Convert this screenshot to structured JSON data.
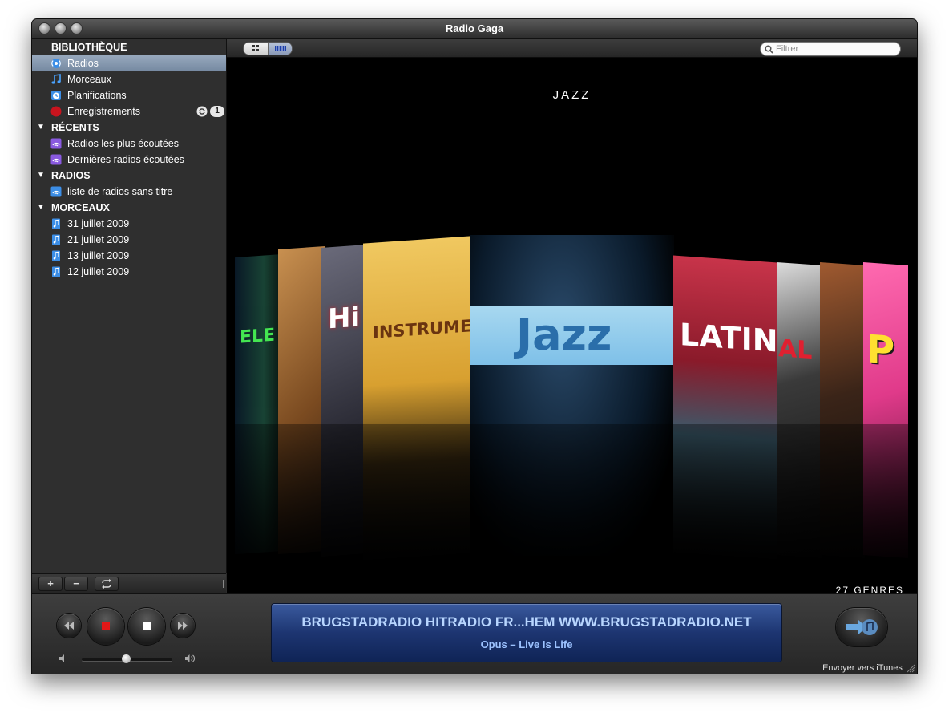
{
  "window": {
    "title": "Radio Gaga"
  },
  "sidebar": {
    "library_header": "BIBLIOTHÈQUE",
    "library_items": [
      {
        "label": "Radios",
        "icon": "radio-icon",
        "selected": true
      },
      {
        "label": "Morceaux",
        "icon": "music-note-icon"
      },
      {
        "label": "Planifications",
        "icon": "clock-icon"
      },
      {
        "label": "Enregistrements",
        "icon": "record-icon",
        "badge": "1"
      }
    ],
    "recent_header": "RÉCENTS",
    "recent_items": [
      {
        "label": "Radios les plus écoutées",
        "icon": "playlist-icon"
      },
      {
        "label": "Dernières radios écoutées",
        "icon": "playlist-icon"
      }
    ],
    "radios_header": "RADIOS",
    "radios_items": [
      {
        "label": "liste de radios sans titre",
        "icon": "radio-list-icon"
      }
    ],
    "tracks_header": "MORCEAUX",
    "tracks_items": [
      {
        "label": "31 juillet 2009",
        "icon": "music-file-icon"
      },
      {
        "label": "21 juillet 2009",
        "icon": "music-file-icon"
      },
      {
        "label": "13 juillet 2009",
        "icon": "music-file-icon"
      },
      {
        "label": "12 juillet 2009",
        "icon": "music-file-icon"
      }
    ],
    "bottom_buttons": {
      "add": "+",
      "remove": "−"
    }
  },
  "toolbar": {
    "filter_placeholder": "Filtrer"
  },
  "coverflow": {
    "current_genre": "JAZZ",
    "count_label": "27 GENRES",
    "covers": [
      {
        "label": "ELE",
        "color": "#1a3a2a"
      },
      {
        "label": "",
        "color": "#8a5a2a"
      },
      {
        "label": "Hi",
        "color": "#3a3a44"
      },
      {
        "label": "INSTRUMENTAL",
        "color": "#e0b040"
      },
      {
        "label": "Jazz",
        "color": "#2f6e9e"
      },
      {
        "label": "LATIN",
        "color": "#b8384a"
      },
      {
        "label": "AL",
        "color": "#2a2a2a"
      },
      {
        "label": "",
        "color": "#3a2418"
      },
      {
        "label": "P",
        "color": "#e03a8a"
      }
    ]
  },
  "player": {
    "station": "BRUGSTADRADIO HITRADIO FR...HEM WWW.BRUGSTADRADIO.NET",
    "track": "Opus – Live Is Life",
    "volume_level": 0.5,
    "send_to_itunes_label": "Envoyer vers iTunes"
  }
}
